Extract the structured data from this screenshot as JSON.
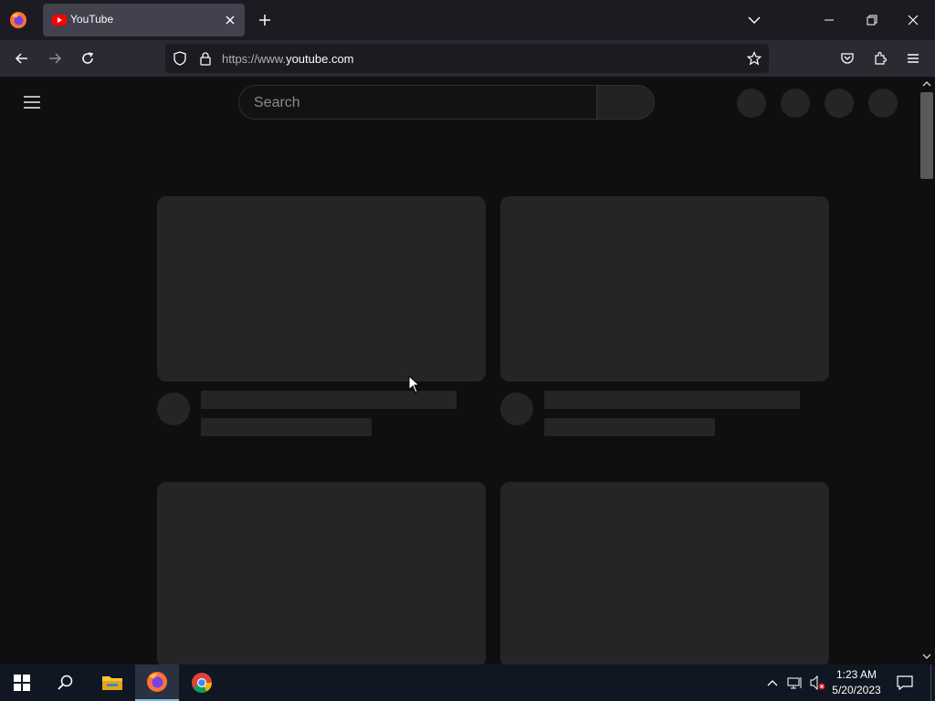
{
  "browser": {
    "tab_title": "YouTube",
    "url_prefix": "https://www.",
    "url_domain": "youtube.com"
  },
  "youtube": {
    "search_placeholder": "Search"
  },
  "taskbar": {
    "time": "1:23 AM",
    "date": "5/20/2023"
  },
  "colors": {
    "youtube_red": "#ff0000",
    "page_bg": "#0f0f0f",
    "skeleton": "#252525"
  }
}
